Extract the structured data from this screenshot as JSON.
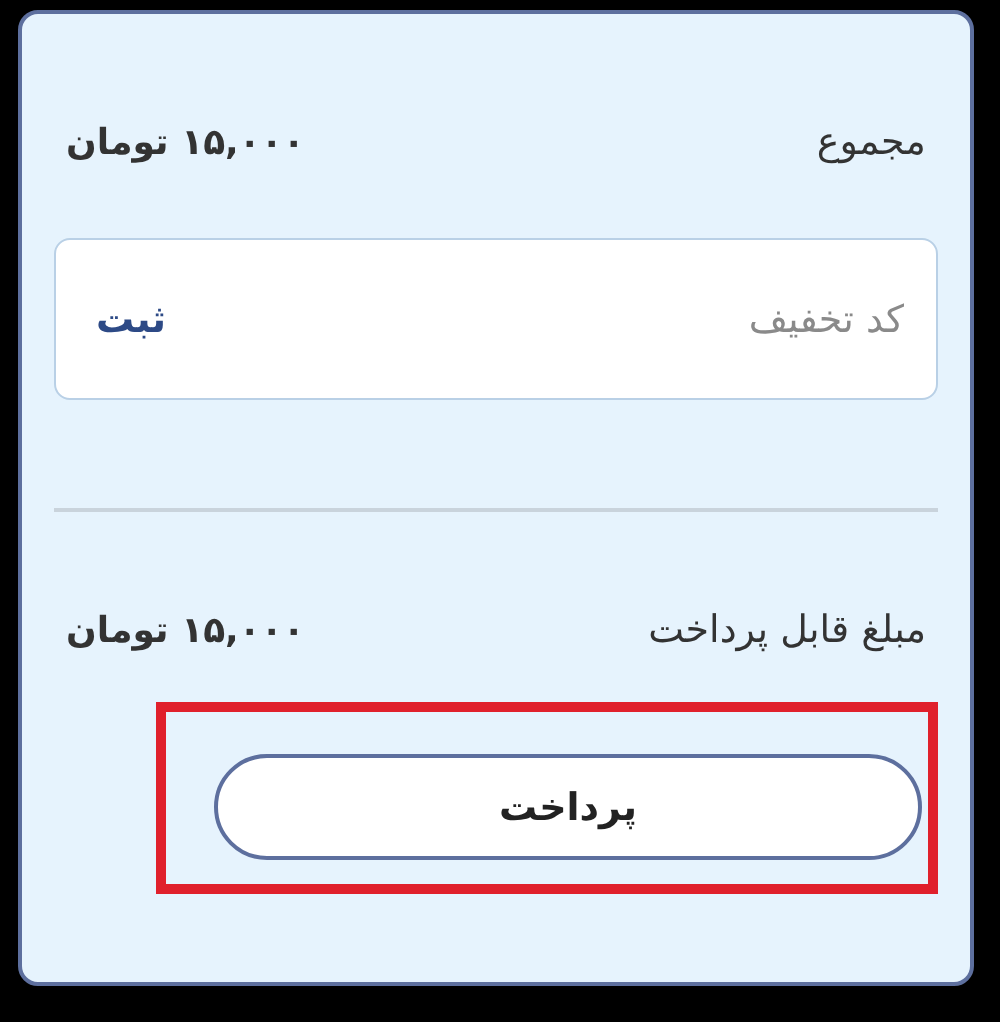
{
  "summary": [
    {
      "label": "مجموع",
      "amount": "۱۵,۰۰۰ تومان"
    }
  ],
  "discount": {
    "placeholder": "کد تخفیف",
    "submit": "ثبت"
  },
  "payable": {
    "label": "مبلغ قابل پرداخت",
    "amount": "۱۵,۰۰۰ تومان"
  },
  "pay_button": {
    "label": "پرداخت",
    "highlighted": true
  }
}
